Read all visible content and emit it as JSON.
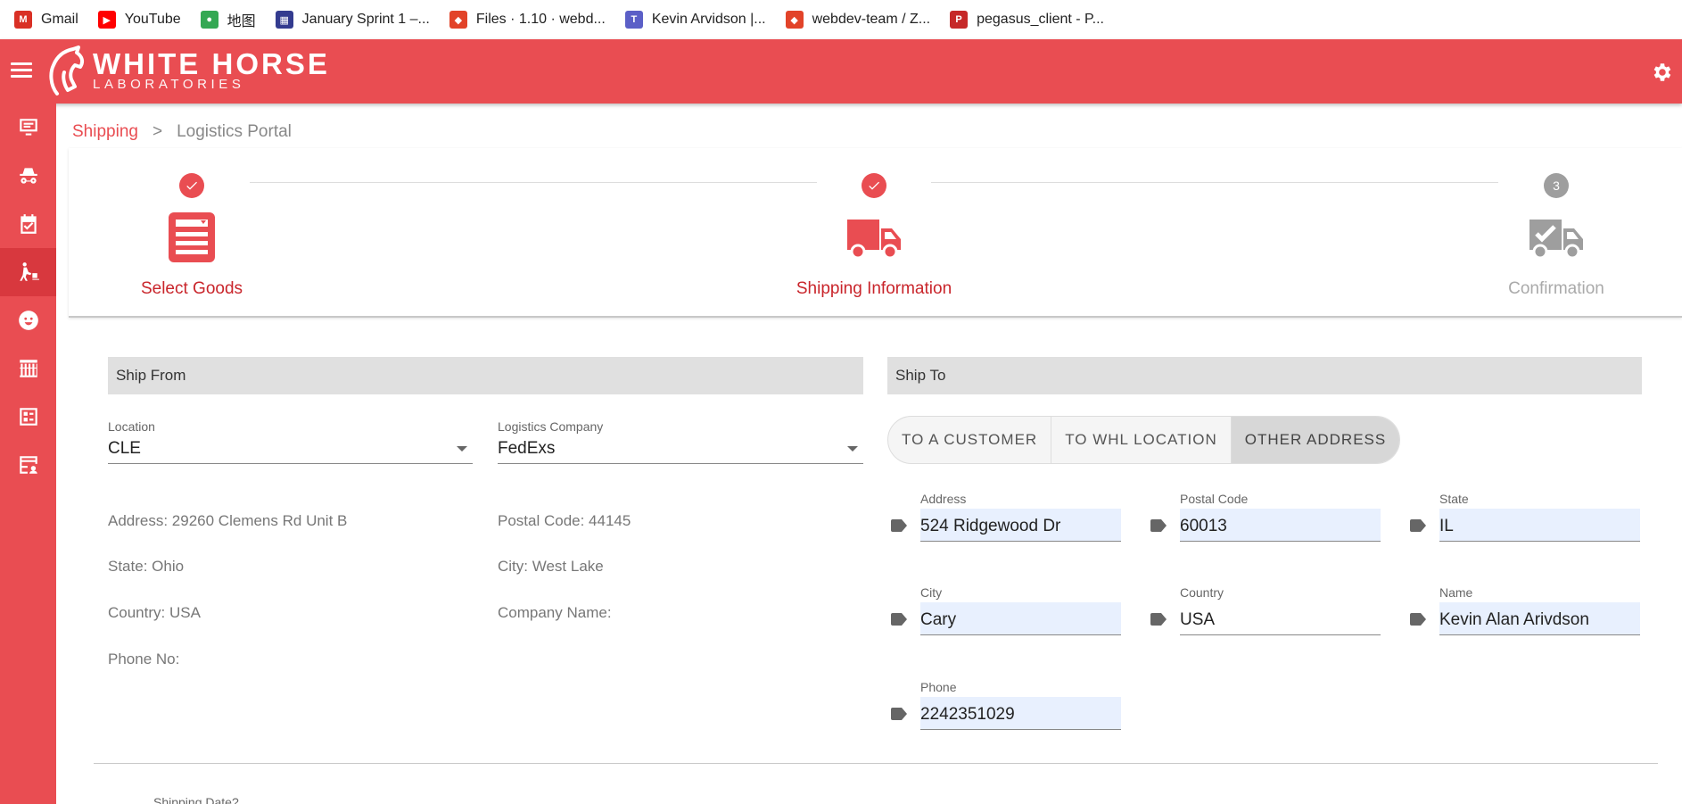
{
  "bookmarks": [
    {
      "label": "Gmail",
      "icon": "gmail-icon",
      "color": "#d93025",
      "glyph": "M"
    },
    {
      "label": "YouTube",
      "icon": "youtube-icon",
      "color": "#ff0000",
      "glyph": "▶"
    },
    {
      "label": "地图",
      "icon": "maps-pin-icon",
      "color": "#34a853",
      "glyph": "●"
    },
    {
      "label": "January Sprint 1 –...",
      "icon": "sprint-board-icon",
      "color": "#333b8f",
      "glyph": "▦"
    },
    {
      "label": "Files · 1.10 · webd...",
      "icon": "gitlab-icon",
      "color": "#e24329",
      "glyph": "◆"
    },
    {
      "label": "Kevin Arvidson |...",
      "icon": "teams-icon",
      "color": "#5b5fc7",
      "glyph": "T"
    },
    {
      "label": "webdev-team / Z...",
      "icon": "gitlab-icon",
      "color": "#e24329",
      "glyph": "◆"
    },
    {
      "label": "pegasus_client - P...",
      "icon": "pegasus-icon",
      "color": "#c62828",
      "glyph": "P"
    }
  ],
  "brand": {
    "title": "WHITE HORSE",
    "subtitle": "LABORATORIES",
    "accent": "#e94d52"
  },
  "sidebar": {
    "items": [
      {
        "name": "monitor-icon"
      },
      {
        "name": "incognito-icon"
      },
      {
        "name": "calendar-check-icon"
      },
      {
        "name": "shipping-dolly-icon",
        "active": true
      },
      {
        "name": "face-icon"
      },
      {
        "name": "warehouse-icon"
      },
      {
        "name": "checklist-icon"
      },
      {
        "name": "table-account-icon"
      }
    ]
  },
  "breadcrumb": {
    "parent": "Shipping",
    "separator": ">",
    "current": "Logistics Portal"
  },
  "stepper": {
    "steps": [
      {
        "label": "Select Goods",
        "status": "done",
        "icon": "form-document-icon"
      },
      {
        "label": "Shipping Information",
        "status": "active",
        "icon": "truck-icon"
      },
      {
        "label": "Confirmation",
        "number": "3",
        "status": "pending",
        "icon": "truck-check-icon"
      }
    ]
  },
  "ship_from": {
    "header": "Ship From",
    "location": {
      "label": "Location",
      "value": "CLE"
    },
    "logistics": {
      "label": "Logistics Company",
      "value": "FedExs"
    },
    "address": "Address: 29260 Clemens Rd Unit B",
    "postal": "Postal Code: 44145",
    "state": "State: Ohio",
    "city": "City: West Lake",
    "country": "Country: USA",
    "company": "Company Name:",
    "phone": "Phone No:"
  },
  "ship_to": {
    "header": "Ship To",
    "tabs": [
      "TO A CUSTOMER",
      "TO WHL LOCATION",
      "OTHER ADDRESS"
    ],
    "active_tab": 2,
    "fields": {
      "address": {
        "label": "Address",
        "value": "524 Ridgewood Dr"
      },
      "postal": {
        "label": "Postal Code",
        "value": "60013"
      },
      "state": {
        "label": "State",
        "value": "IL"
      },
      "city": {
        "label": "City",
        "value": "Cary"
      },
      "country": {
        "label": "Country",
        "value": "USA"
      },
      "name": {
        "label": "Name",
        "value": "Kevin Alan Arivdson"
      },
      "phone": {
        "label": "Phone",
        "value": "2242351029"
      }
    }
  },
  "shipping_date_label": "Shipping Date?"
}
